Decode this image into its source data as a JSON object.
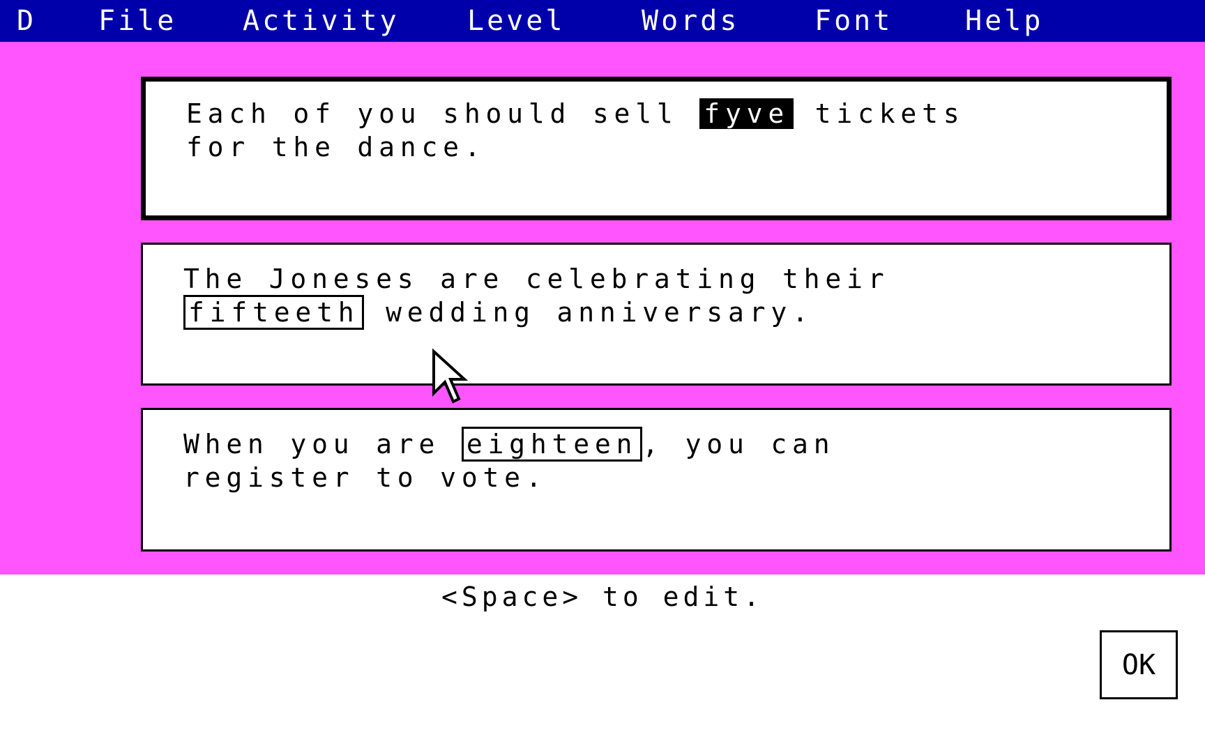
{
  "colors": {
    "menubar": "#0000aa",
    "background": "#ff55ff"
  },
  "menu": [
    "D",
    "File",
    "Activity",
    "Level",
    "Words",
    "Font",
    "Help"
  ],
  "sentences": [
    {
      "line1_before": "Each of you should sell ",
      "word": "fyve",
      "line1_after": " tickets",
      "line2": "for the dance.",
      "word_style": "highlighted"
    },
    {
      "line1": "The Joneses are celebrating their",
      "word": "fifteeth",
      "line2_after": " wedding anniversary.",
      "word_style": "framed"
    },
    {
      "line1_before": "When you are ",
      "word": "eighteen",
      "line1_after": ", you can",
      "line2": "register to vote.",
      "word_style": "framed"
    }
  ],
  "status": "<Space> to edit.",
  "ok_label": "OK",
  "cursor_icon": "arrow-pointer"
}
